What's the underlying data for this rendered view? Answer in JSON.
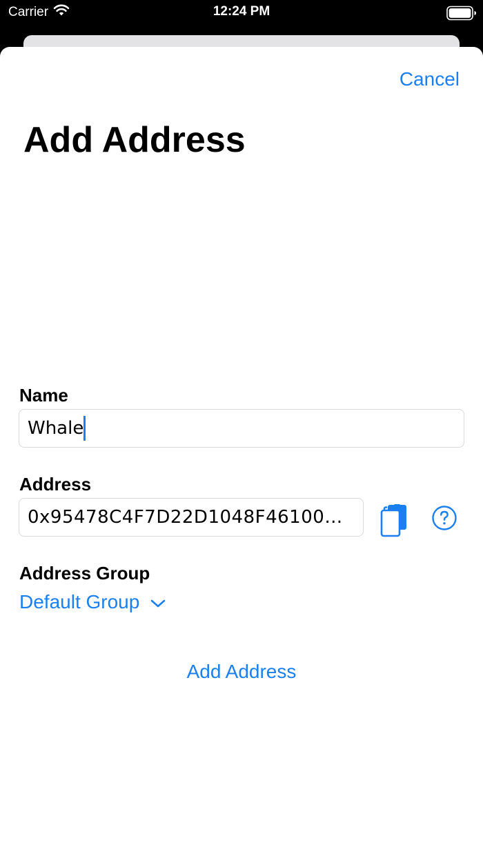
{
  "status_bar": {
    "carrier": "Carrier",
    "time": "12:24 PM"
  },
  "header": {
    "cancel_label": "Cancel",
    "title": "Add Address"
  },
  "form": {
    "name": {
      "label": "Name",
      "value": "Whale"
    },
    "address": {
      "label": "Address",
      "value": "0x95478C4F7D22D1048F461000..."
    },
    "group": {
      "label": "Address Group",
      "selected": "Default Group"
    },
    "submit_label": "Add Address"
  },
  "icons": {
    "paste": "paste-clipboard-icon",
    "help": "question-circle-icon",
    "dropdown": "chevron-down-icon"
  },
  "colors": {
    "accent": "#1a7ff0",
    "background": "#ffffff",
    "status_bar": "#000000"
  }
}
